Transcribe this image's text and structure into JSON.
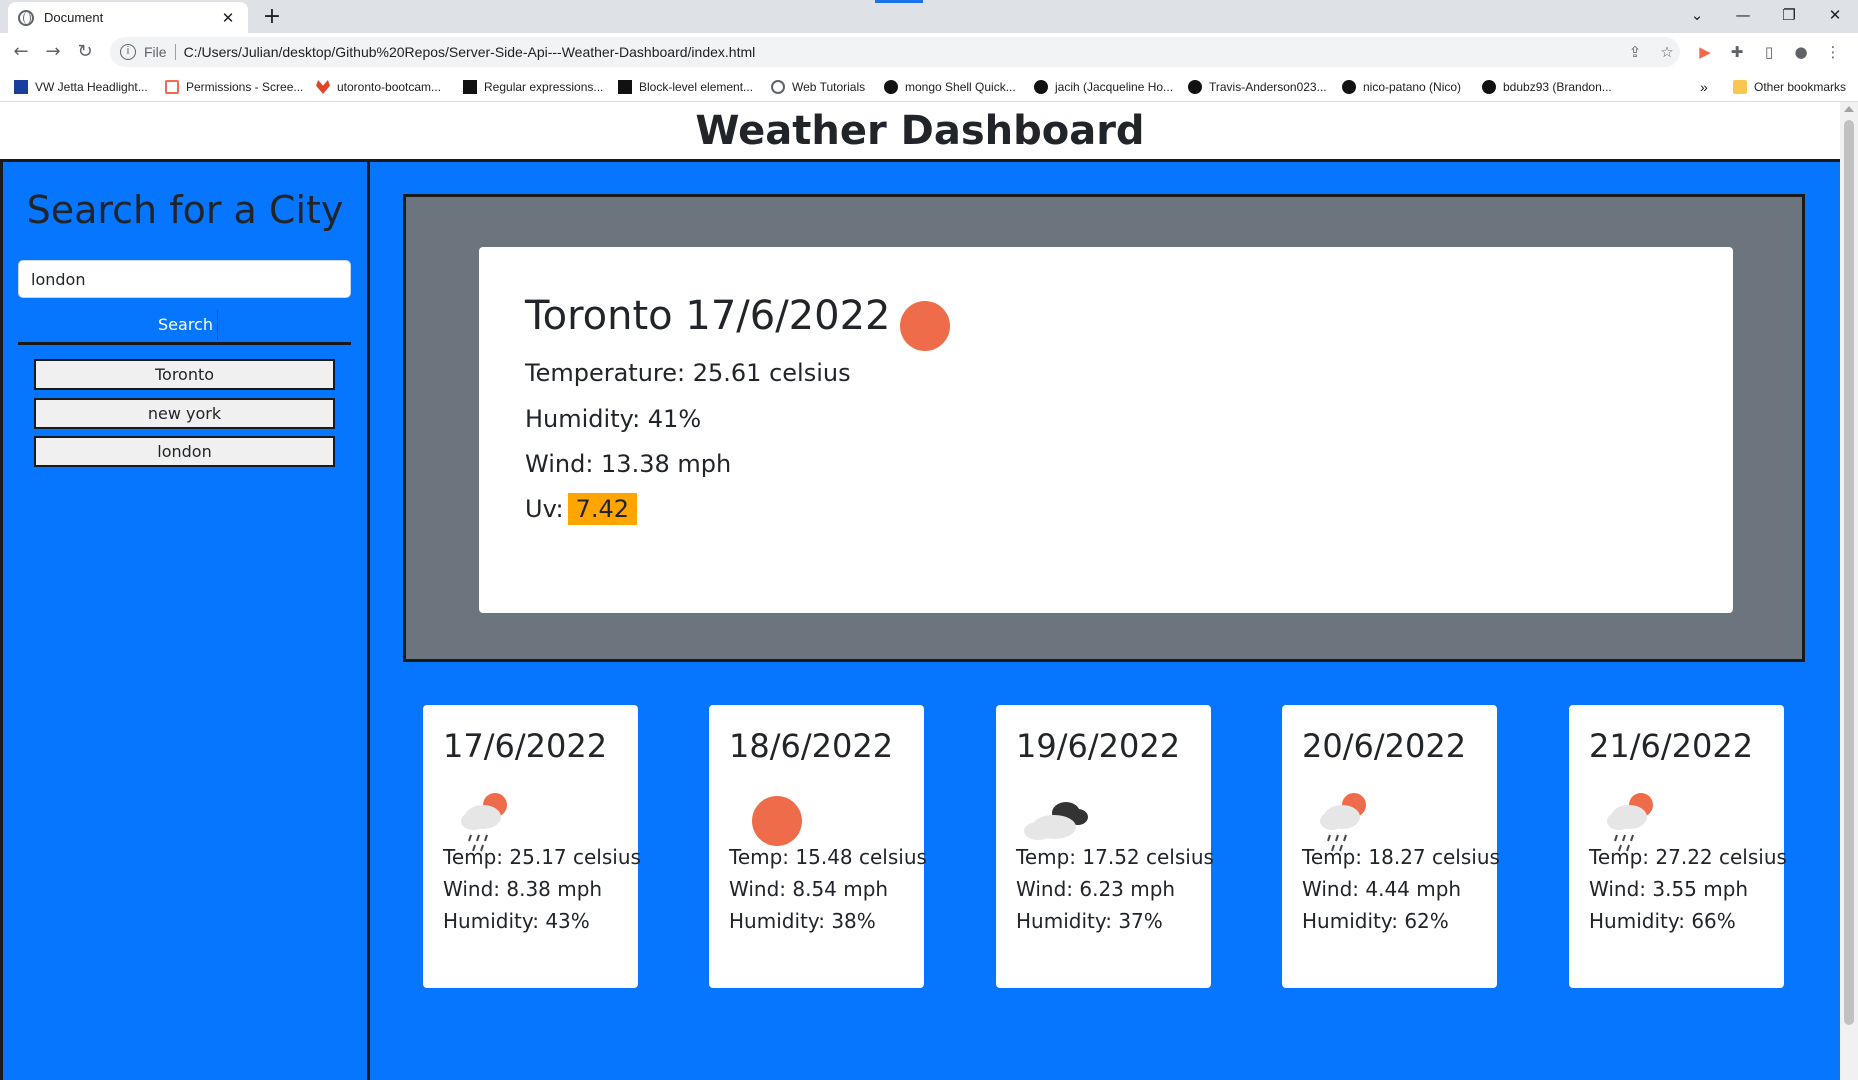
{
  "browser": {
    "tab_title": "Document",
    "tab_close": "✕",
    "new_tab": "+",
    "scheme": "File",
    "url": "C:/Users/Julian/desktop/Github%20Repos/Server-Side-Api---Weather-Dashboard/index.html",
    "bookmarks": [
      "VW Jetta Headlight...",
      "Permissions - Scree...",
      "utoronto-bootcam...",
      "Regular expressions...",
      "Block-level element...",
      "Web Tutorials",
      "mongo Shell Quick...",
      "jacih (Jacqueline Ho...",
      "Travis-Anderson023...",
      "nico-patano (Nico)",
      "bdubz93 (Brandon..."
    ],
    "bookmarks_more": "»",
    "other_bookmarks": "Other bookmarks"
  },
  "page": {
    "title": "Weather Dashboard"
  },
  "sidebar": {
    "heading": "Search for a City",
    "search_value": "london",
    "search_button": "Search",
    "history": [
      "Toronto",
      "new york",
      "london"
    ]
  },
  "current": {
    "title": "Toronto 17/6/2022",
    "icon": "sun-icon",
    "temperature": "Temperature: 25.61 celsius",
    "humidity": "Humidity: 41%",
    "wind": "Wind: 13.38 mph",
    "uv_label": "Uv:",
    "uv_value": "7.42",
    "uv_color": "#ffa500"
  },
  "forecast": [
    {
      "date": "17/6/2022",
      "icon": "sun-rain-icon",
      "temp": "Temp: 25.17 celsius",
      "wind": "Wind: 8.38 mph",
      "humidity": "Humidity: 43%"
    },
    {
      "date": "18/6/2022",
      "icon": "sun-icon",
      "temp": "Temp: 15.48 celsius",
      "wind": "Wind: 8.54 mph",
      "humidity": "Humidity: 38%"
    },
    {
      "date": "19/6/2022",
      "icon": "cloudy-icon",
      "temp": "Temp: 17.52 celsius",
      "wind": "Wind: 6.23 mph",
      "humidity": "Humidity: 37%"
    },
    {
      "date": "20/6/2022",
      "icon": "sun-rain-icon",
      "temp": "Temp: 18.27 celsius",
      "wind": "Wind: 4.44 mph",
      "humidity": "Humidity: 62%"
    },
    {
      "date": "21/6/2022",
      "icon": "sun-rain-icon",
      "temp": "Temp: 27.22 celsius",
      "wind": "Wind: 3.55 mph",
      "humidity": "Humidity: 66%"
    }
  ],
  "colors": {
    "accent_blue": "#0776fe",
    "panel_gray": "#6c757d",
    "sun": "#ef6c4a"
  }
}
